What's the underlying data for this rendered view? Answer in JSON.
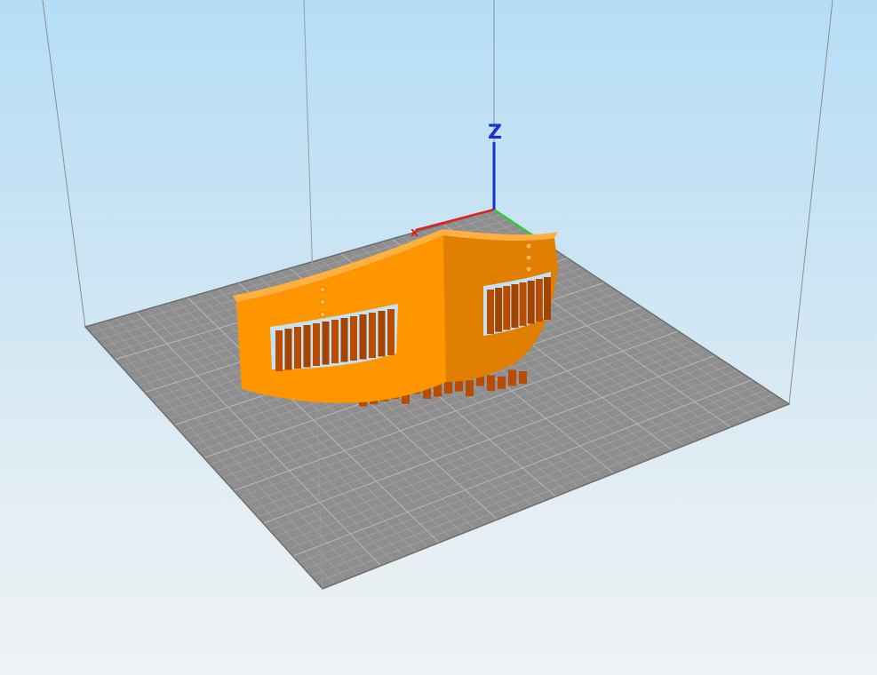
{
  "viewport": {
    "background_top": "#b5ddf6",
    "background_bottom": "#eef2f4"
  },
  "bed": {
    "color": "#8e8e8e",
    "grid_color": "#a9a9a9",
    "edge_color": "#6e6e6e"
  },
  "axes": {
    "x_color": "#e0201e",
    "y_color": "#2fcc2f",
    "z_color": "#1533c8",
    "x_label": "x",
    "z_label": "Z"
  },
  "model": {
    "body_color": "#ff9600",
    "shade_color": "#e07f00",
    "support_color": "#b84c00"
  }
}
